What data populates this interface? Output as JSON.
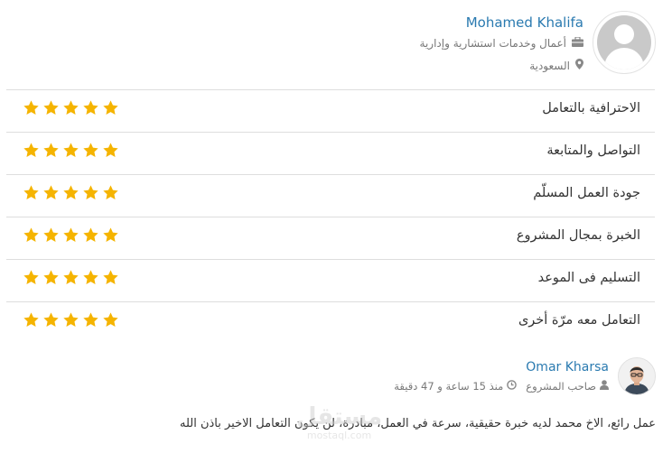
{
  "freelancer": {
    "name": "Mohamed Khalifa",
    "category": "أعمال وخدمات استشارية وإدارية",
    "location": "السعودية",
    "category_icon": "briefcase-icon",
    "location_icon": "map-marker-icon"
  },
  "ratings": [
    {
      "label": "الاحترافية بالتعامل",
      "stars": 5
    },
    {
      "label": "التواصل والمتابعة",
      "stars": 5
    },
    {
      "label": "جودة العمل المسلّم",
      "stars": 5
    },
    {
      "label": "الخبرة بمجال المشروع",
      "stars": 5
    },
    {
      "label": "التسليم فى الموعد",
      "stars": 5
    },
    {
      "label": "التعامل معه مرّة أخرى",
      "stars": 5
    }
  ],
  "review": {
    "reviewer_name": "Omar Kharsa",
    "role": "صاحب المشروع",
    "time_ago": "منذ 15 ساعة و 47 دقيقة",
    "text": "عمل رائع، الاخ محمد لديه خبرة حقيقية، سرعة في العمل، مبادرة، لن يكون التعامل الاخير باذن الله"
  },
  "watermark": {
    "arabic": "مستقل",
    "latin": "mostaql.com"
  },
  "colors": {
    "link": "#2a7ab0",
    "star": "#f5b400",
    "divider": "#dedede"
  }
}
